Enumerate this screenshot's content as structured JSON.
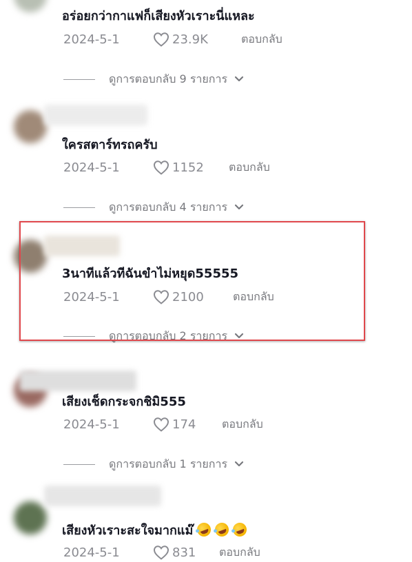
{
  "comments": [
    {
      "text": "อร่อยกว่ากาแฟก็เสียงหัวเราะนี่แหละ",
      "date": "2024-5-1",
      "likes": "23.9K",
      "reply_label": "ตอบกลับ",
      "view_replies": "ดูการตอบกลับ 9 รายการ"
    },
    {
      "text": "ใครสตาร์ทรถครับ",
      "date": "2024-5-1",
      "likes": "1152",
      "reply_label": "ตอบกลับ",
      "view_replies": "ดูการตอบกลับ 4 รายการ"
    },
    {
      "text": "3นาทีแล้วทีฉันขำไม่หยุด55555",
      "date": "2024-5-1",
      "likes": "2100",
      "reply_label": "ตอบกลับ",
      "view_replies": "ดูการตอบกลับ 2 รายการ"
    },
    {
      "text": "เสียงเช็ดกระจกชิมิ555",
      "date": "2024-5-1",
      "likes": "174",
      "reply_label": "ตอบกลับ",
      "view_replies": "ดูการตอบกลับ 1 รายการ"
    },
    {
      "text": "เสียงหัวเราะสะใจมากแม๊",
      "emoji_name": "rolling-on-floor-laughing-emoji",
      "emoji_count": 3,
      "date": "2024-5-1",
      "likes": "831",
      "reply_label": "ตอบกลับ"
    }
  ],
  "icons": {
    "like": "heart-outline-icon",
    "expand": "chevron-down-icon"
  },
  "colors": {
    "text": "#161823",
    "meta": "#8a8b91",
    "highlight": "#e0474c"
  }
}
